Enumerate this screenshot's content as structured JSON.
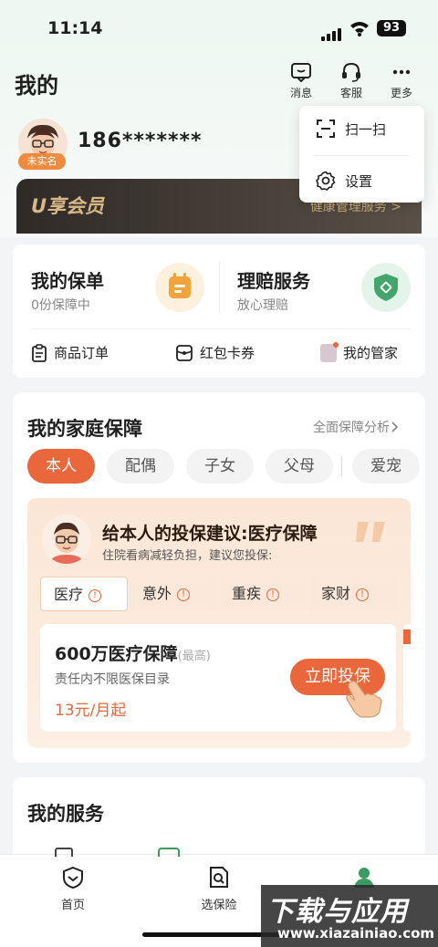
{
  "status_bar": {
    "time": "11:14",
    "battery": "93"
  },
  "header": {
    "title": "我的",
    "actions": [
      {
        "label": "消息",
        "icon": "message-icon"
      },
      {
        "label": "客服",
        "icon": "headset-icon"
      },
      {
        "label": "更多",
        "icon": "more-icon"
      }
    ]
  },
  "dropdown_menu": [
    {
      "label": "扫一扫",
      "icon": "scan-icon"
    },
    {
      "label": "设置",
      "icon": "gear-icon"
    }
  ],
  "profile": {
    "badge": "未实名",
    "phone": "186*******"
  },
  "vip_banner": {
    "name": "U享会员",
    "service": "健康管理服务 >"
  },
  "policy_card": {
    "my_policy": {
      "title": "我的保单",
      "sub": "0份保障中"
    },
    "claims": {
      "title": "理赔服务",
      "sub": "放心理赔"
    },
    "quick_links": [
      {
        "label": "商品订单",
        "icon": "clipboard-icon"
      },
      {
        "label": "红包卡券",
        "icon": "coupon-icon"
      },
      {
        "label": "我的管家",
        "icon": "manager-avatar-icon"
      }
    ]
  },
  "family": {
    "title": "我的家庭保障",
    "link": "全面保障分析",
    "members": [
      "本人",
      "配偶",
      "子女",
      "父母",
      "爱宠"
    ],
    "active_member": "本人",
    "advice_title": "给本人的投保建议:医疗保障",
    "advice_sub": "住院看病减轻负担，建议您投保:",
    "tabs": [
      "医疗",
      "意外",
      "重疾",
      "家财"
    ],
    "product": {
      "name": "600万医疗保障",
      "name_note": "(最高)",
      "desc": "责任内不限医保目录",
      "price": "13元/月起",
      "button": "立即投保"
    }
  },
  "services": {
    "title": "我的服务"
  },
  "tabbar": [
    {
      "label": "首页",
      "icon": "shield-home-icon"
    },
    {
      "label": "选保险",
      "icon": "search-doc-icon"
    },
    {
      "label": "",
      "icon": "star-icon"
    },
    {
      "label": "",
      "icon": "profile-icon"
    }
  ],
  "watermark": {
    "title": "下载与应用",
    "url": "www.xiazainiao.com"
  },
  "colors": {
    "accent": "#e9673a",
    "green": "#3a9a60",
    "vip_gold": "#d9b887"
  }
}
